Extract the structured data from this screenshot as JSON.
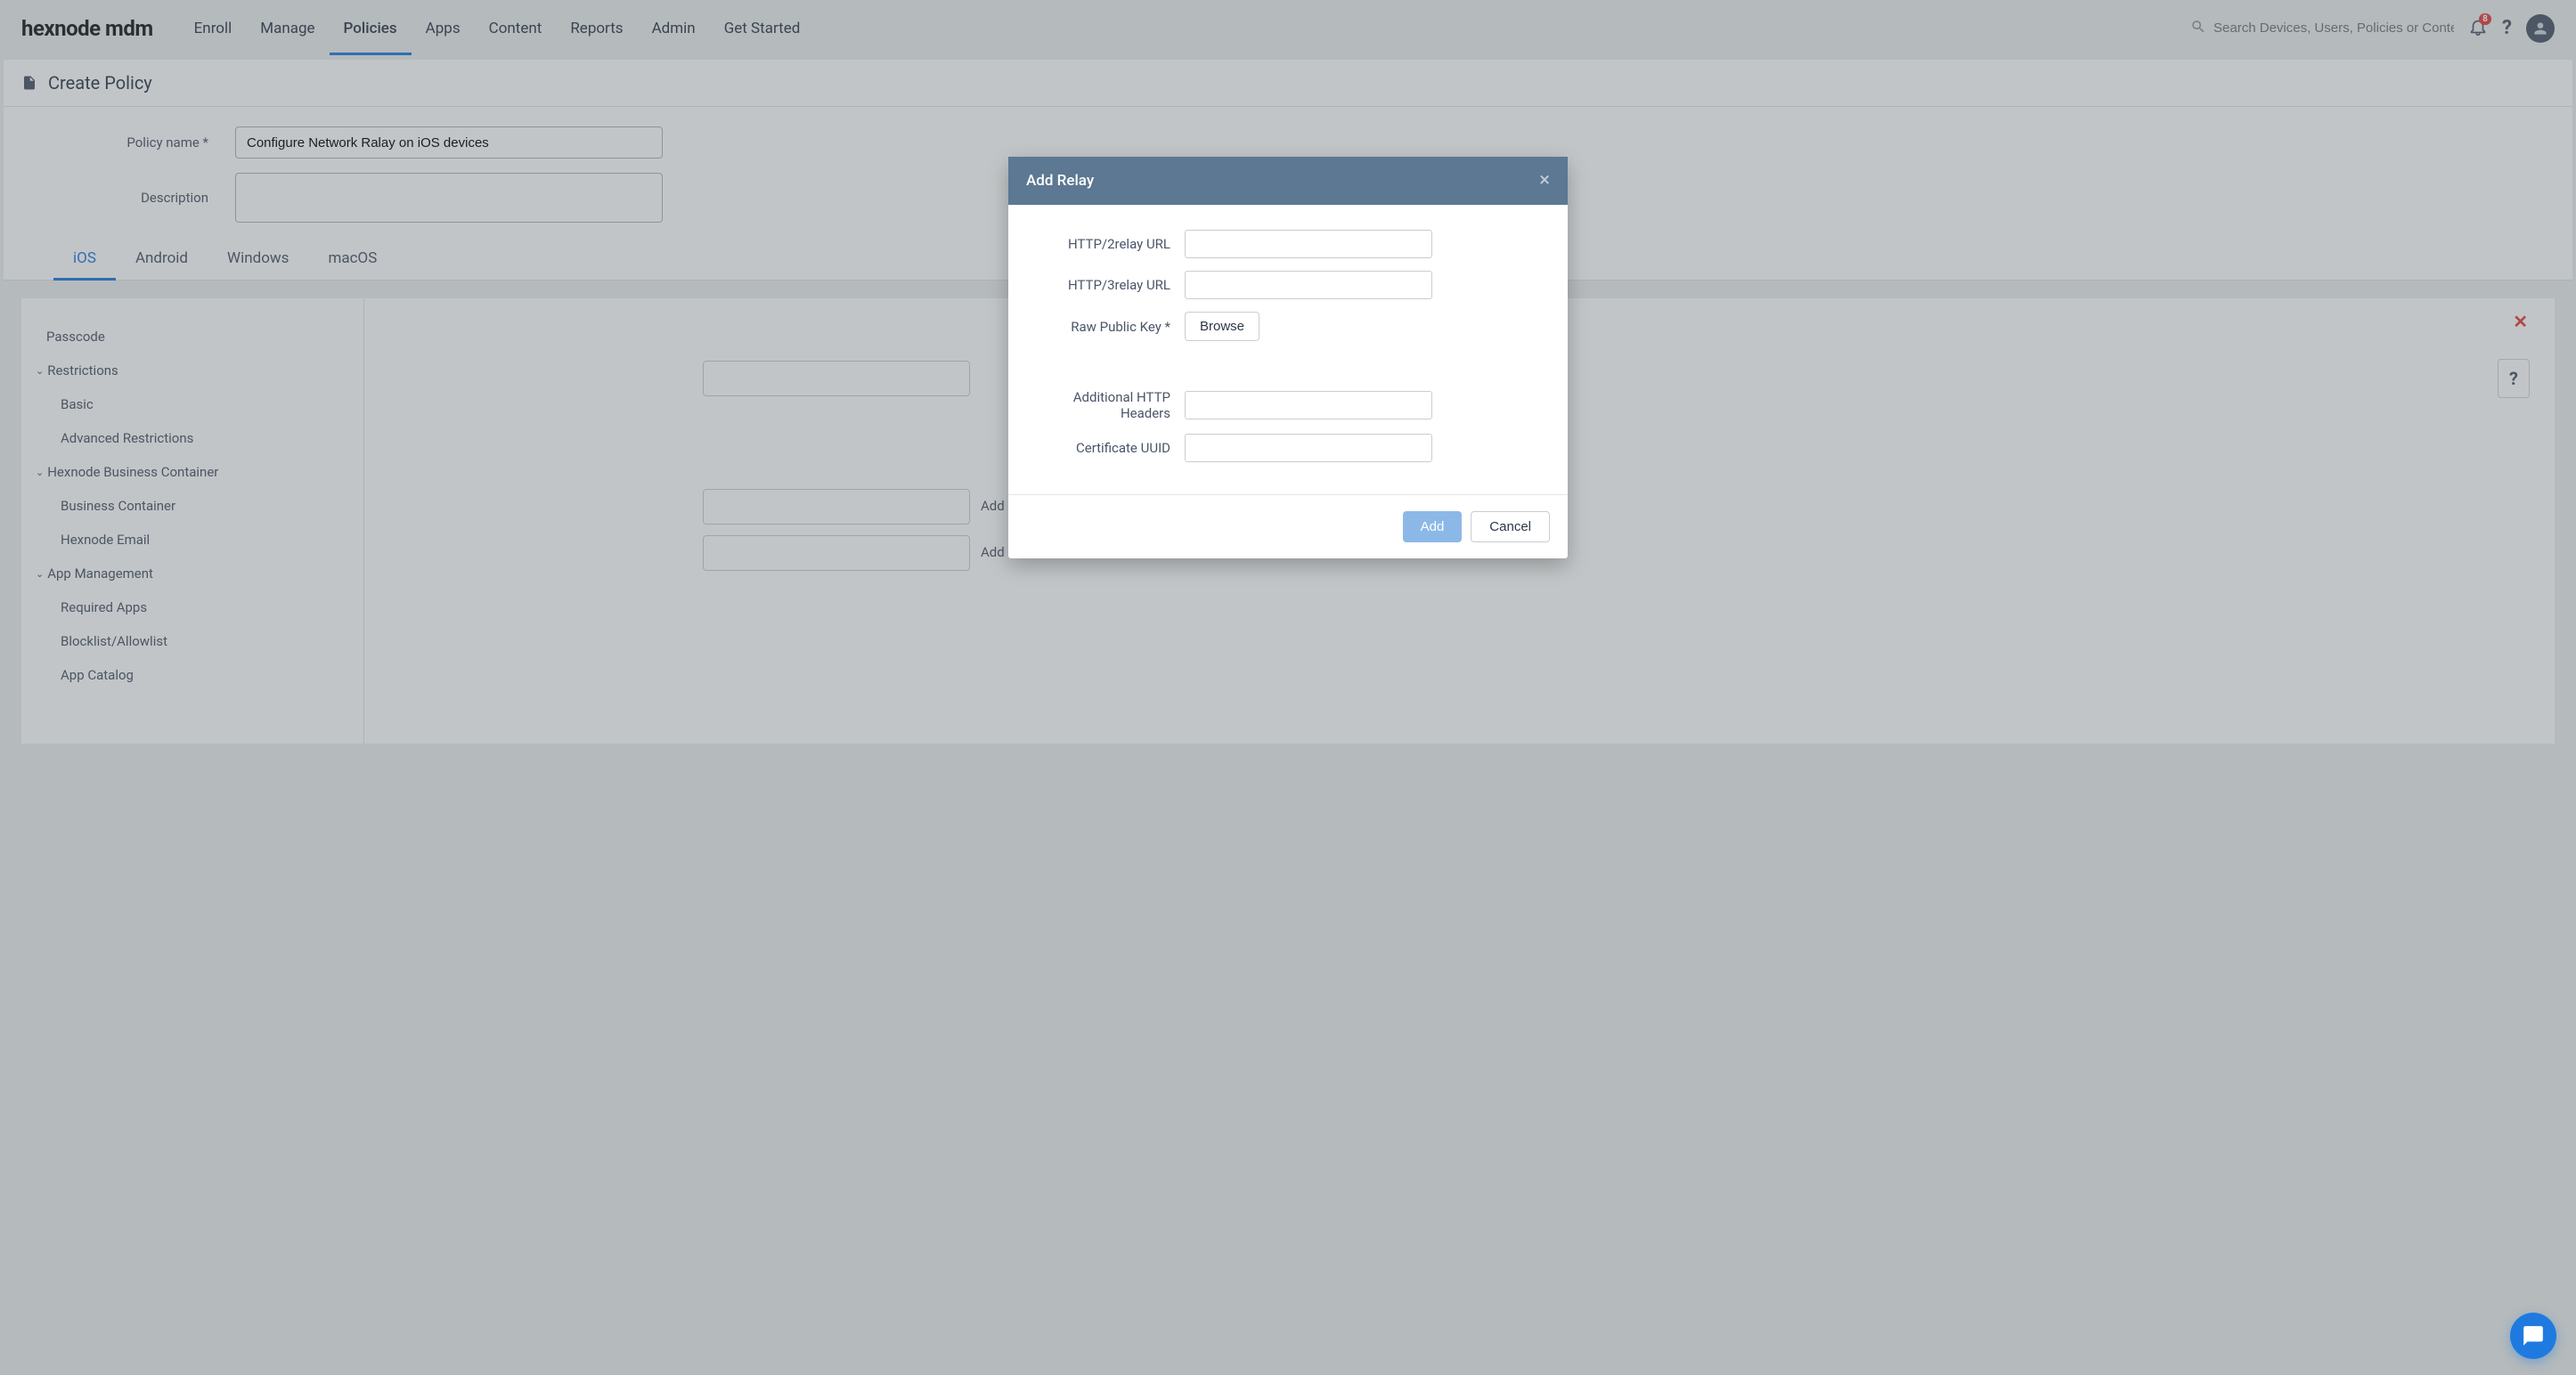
{
  "header": {
    "logo": "hexnode mdm",
    "nav": [
      "Enroll",
      "Manage",
      "Policies",
      "Apps",
      "Content",
      "Reports",
      "Admin",
      "Get Started"
    ],
    "active_nav_index": 2,
    "search_placeholder": "Search Devices, Users, Policies or Content",
    "notification_count": "8"
  },
  "page": {
    "title": "Create Policy",
    "policy_name_label": "Policy name *",
    "policy_name_value": "Configure Network Ralay on iOS devices",
    "description_label": "Description",
    "description_value": ""
  },
  "os_tabs": [
    "iOS",
    "Android",
    "Windows",
    "macOS"
  ],
  "active_os_index": 0,
  "sidebar": {
    "items": [
      {
        "type": "item",
        "label": "Passcode"
      },
      {
        "type": "group",
        "label": "Restrictions"
      },
      {
        "type": "sub",
        "label": "Basic"
      },
      {
        "type": "sub",
        "label": "Advanced Restrictions"
      },
      {
        "type": "group",
        "label": "Hexnode Business Container"
      },
      {
        "type": "sub",
        "label": "Business Container"
      },
      {
        "type": "sub",
        "label": "Hexnode Email"
      },
      {
        "type": "group",
        "label": "App Management"
      },
      {
        "type": "sub",
        "label": "Required Apps"
      },
      {
        "type": "sub",
        "label": "Blocklist/Allowlist"
      },
      {
        "type": "sub",
        "label": "App Catalog"
      }
    ]
  },
  "pane": {
    "add_plus": "Add +",
    "help_q": "?"
  },
  "modal": {
    "title": "Add Relay",
    "fields": {
      "http2": "HTTP/2relay URL",
      "http3": "HTTP/3relay URL",
      "rawkey": "Raw Public Key *",
      "browse": "Browse",
      "headers": "Additional HTTP Headers",
      "cert": "Certificate UUID"
    },
    "values": {
      "http2": "",
      "http3": "",
      "headers": "",
      "cert": ""
    },
    "buttons": {
      "add": "Add",
      "cancel": "Cancel"
    }
  }
}
